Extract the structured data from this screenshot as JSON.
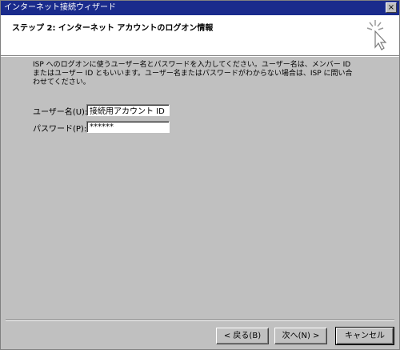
{
  "window": {
    "title": "インターネット接続ウィザード",
    "close_glyph": "×"
  },
  "header": {
    "step": "ステップ 2: インターネット アカウントのログオン情報",
    "icon": "wizard-cursor-sparkle-icon"
  },
  "description": "ISP へのログオンに使うユーザー名とパスワードを入力してください。ユーザー名は、メンバー ID またはユーザー ID ともいいます。ユーザー名またはパスワードがわからない場合は、ISP に問い合わせてください。",
  "form": {
    "username_label": "ユーザー名(U):",
    "username_value": "接続用アカウント ID",
    "password_label": "パスワード(P):",
    "password_value": "******"
  },
  "buttons": {
    "back": "< 戻る(B)",
    "next": "次へ(N) >",
    "cancel": "キャンセル"
  }
}
